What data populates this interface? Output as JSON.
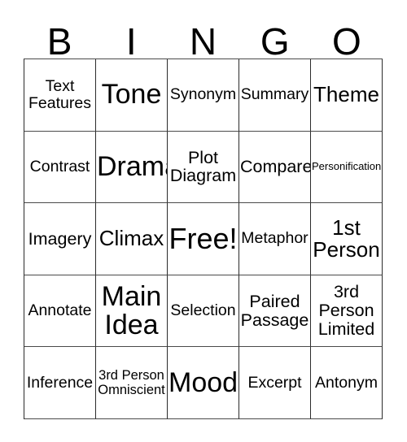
{
  "card": {
    "header_letters": [
      "B",
      "I",
      "N",
      "G",
      "O"
    ],
    "rows": [
      [
        {
          "label": "Text\nFeatures",
          "size": "sz-md"
        },
        {
          "label": "Tone",
          "size": "sz-xxl"
        },
        {
          "label": "Synonym",
          "size": "sz-md"
        },
        {
          "label": "Summary",
          "size": "sz-md"
        },
        {
          "label": "Theme",
          "size": "sz-xl"
        }
      ],
      [
        {
          "label": "Contrast",
          "size": "sz-md"
        },
        {
          "label": "Drama",
          "size": "sz-xxl"
        },
        {
          "label": "Plot\nDiagram",
          "size": "sz-lg"
        },
        {
          "label": "Compare",
          "size": "sz-lg"
        },
        {
          "label": "Personification",
          "size": "sz-xs"
        }
      ],
      [
        {
          "label": "Imagery",
          "size": "sz-lg"
        },
        {
          "label": "Climax",
          "size": "sz-xl"
        },
        {
          "label": "Free!",
          "size": "sz-free"
        },
        {
          "label": "Metaphor",
          "size": "sz-md"
        },
        {
          "label": "1st\nPerson",
          "size": "sz-xl"
        }
      ],
      [
        {
          "label": "Annotate",
          "size": "sz-md"
        },
        {
          "label": "Main\nIdea",
          "size": "sz-xxl"
        },
        {
          "label": "Selection",
          "size": "sz-md"
        },
        {
          "label": "Paired\nPassage",
          "size": "sz-lg"
        },
        {
          "label": "3rd\nPerson\nLimited",
          "size": "sz-lg"
        }
      ],
      [
        {
          "label": "Inference",
          "size": "sz-md"
        },
        {
          "label": "3rd Person\nOmniscient",
          "size": "sz-sm"
        },
        {
          "label": "Mood",
          "size": "sz-xxl"
        },
        {
          "label": "Excerpt",
          "size": "sz-md"
        },
        {
          "label": "Antonym",
          "size": "sz-md"
        }
      ]
    ],
    "colors": {
      "background": "#ffffff",
      "text": "#000000",
      "grid_line": "#2b2b2b"
    }
  }
}
